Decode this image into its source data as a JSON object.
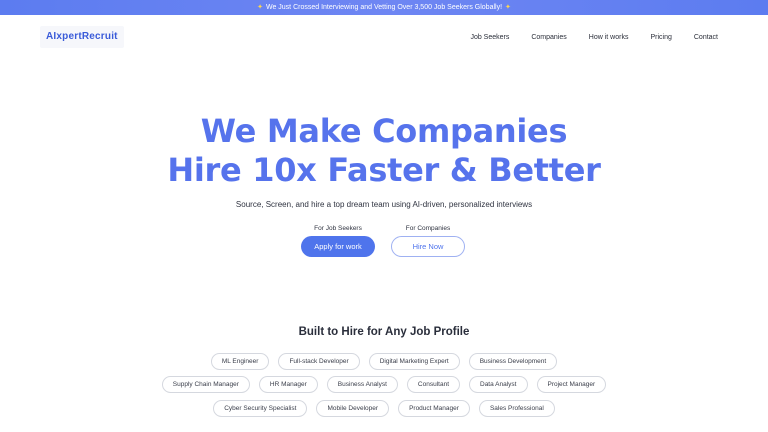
{
  "announcement": {
    "text": "We Just Crossed Interviewing and Vetting Over 3,500 Job Seekers Globally!"
  },
  "nav": {
    "logo": {
      "prefix": "AI",
      "rest": "xpertRecruit"
    },
    "links": [
      "Job Seekers",
      "Companies",
      "How it works",
      "Pricing",
      "Contact"
    ]
  },
  "hero": {
    "title_line1": "We Make Companies",
    "title_line2": "Hire 10x Faster & Better",
    "subtitle": "Source, Screen, and hire a top dream team using AI-driven, personalized interviews"
  },
  "cta": {
    "seekers": {
      "label": "For Job Seekers",
      "button": "Apply for work"
    },
    "companies": {
      "label": "For Companies",
      "button": "Hire Now"
    }
  },
  "profiles": {
    "title": "Built to Hire for Any Job Profile",
    "row1": [
      "ML Engineer",
      "Full-stack Developer",
      "Digital Marketing Expert",
      "Business Development"
    ],
    "row2": [
      "Supply Chain Manager",
      "HR Manager",
      "Business Analyst",
      "Consultant",
      "Data Analyst",
      "Project Manager"
    ],
    "row3": [
      "Cyber Security Specialist",
      "Mobile Developer",
      "Product Manager",
      "Sales Professional"
    ]
  },
  "colors": {
    "brand": "#5673ec",
    "button": "#4f74ec",
    "banner": "#5c7cf0"
  }
}
